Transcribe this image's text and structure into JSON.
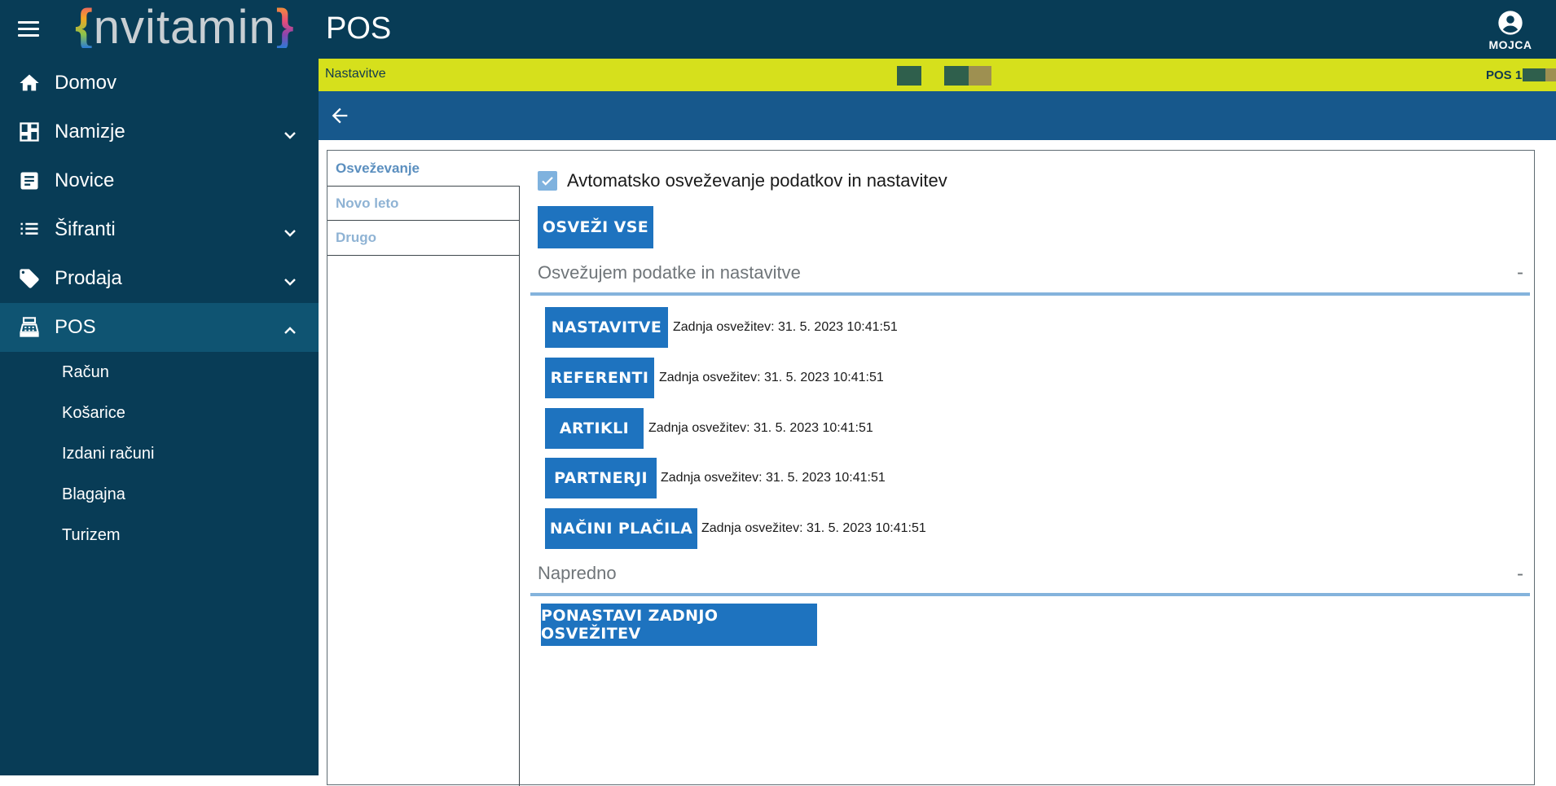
{
  "header": {
    "menu_icon": "hamburger-menu-icon",
    "logo_left_brace": "{",
    "logo_text": "nvitamin",
    "logo_right_brace": "}",
    "title": "POS",
    "user_icon": "account-circle-icon",
    "user_name": "MOJCA"
  },
  "sidebar": {
    "items": [
      {
        "label": "Domov",
        "icon": "home-icon"
      },
      {
        "label": "Namizje",
        "icon": "dashboard-icon"
      },
      {
        "label": "Novice",
        "icon": "article-icon"
      },
      {
        "label": "Šifranti",
        "icon": "list-icon"
      },
      {
        "label": "Prodaja",
        "icon": "tag-icon"
      },
      {
        "label": "POS",
        "icon": "cash-register-icon"
      }
    ],
    "pos_subitems": [
      "Račun",
      "Košarice",
      "Izdani računi",
      "Blagajna",
      "Turizem"
    ]
  },
  "yellow_bar": {
    "left_text": "Nastavitve",
    "right_text": "POS 1",
    "swatch_colors": [
      "#2f5f4c",
      "#2f5f4c",
      "#9e9051"
    ]
  },
  "toolbar": {
    "back_icon": "arrow-back-icon"
  },
  "tabs": {
    "items": [
      "Osveževanje",
      "Novo leto",
      "Drugo"
    ],
    "active": "Osveževanje"
  },
  "refresh": {
    "auto_checkbox_label": "Avtomatsko osveževanje podatkov in nastavitev",
    "auto_checked": true,
    "refresh_all_button": "OSVEŽI VSE",
    "section1_title": "Osvežujem podatke in nastavitve",
    "section1_toggle": "-",
    "rows": [
      {
        "button": "NASTAVITVE",
        "status": "Zadnja osvežitev: 31. 5. 2023 10:41:51"
      },
      {
        "button": "REFERENTI",
        "status": "Zadnja osvežitev: 31. 5. 2023 10:41:51"
      },
      {
        "button": "ARTIKLI",
        "status": "Zadnja osvežitev: 31. 5. 2023 10:41:51"
      },
      {
        "button": "PARTNERJI",
        "status": "Zadnja osvežitev: 31. 5. 2023 10:41:51"
      },
      {
        "button": "NAČINI PLAČILA",
        "status": "Zadnja osvežitev: 31. 5. 2023 10:41:51"
      }
    ],
    "section2_title": "Napredno",
    "section2_toggle": "-",
    "reset_button": "PONASTAVI ZADNJO OSVEŽITEV"
  },
  "colors": {
    "header_bg": "#083c56",
    "sidebar_active_bg": "#0f5472",
    "yellow_bar": "#d6e01c",
    "toolbar_bg": "#17588c",
    "button_bg": "#1e73bf",
    "section_line": "#84b3dc"
  }
}
